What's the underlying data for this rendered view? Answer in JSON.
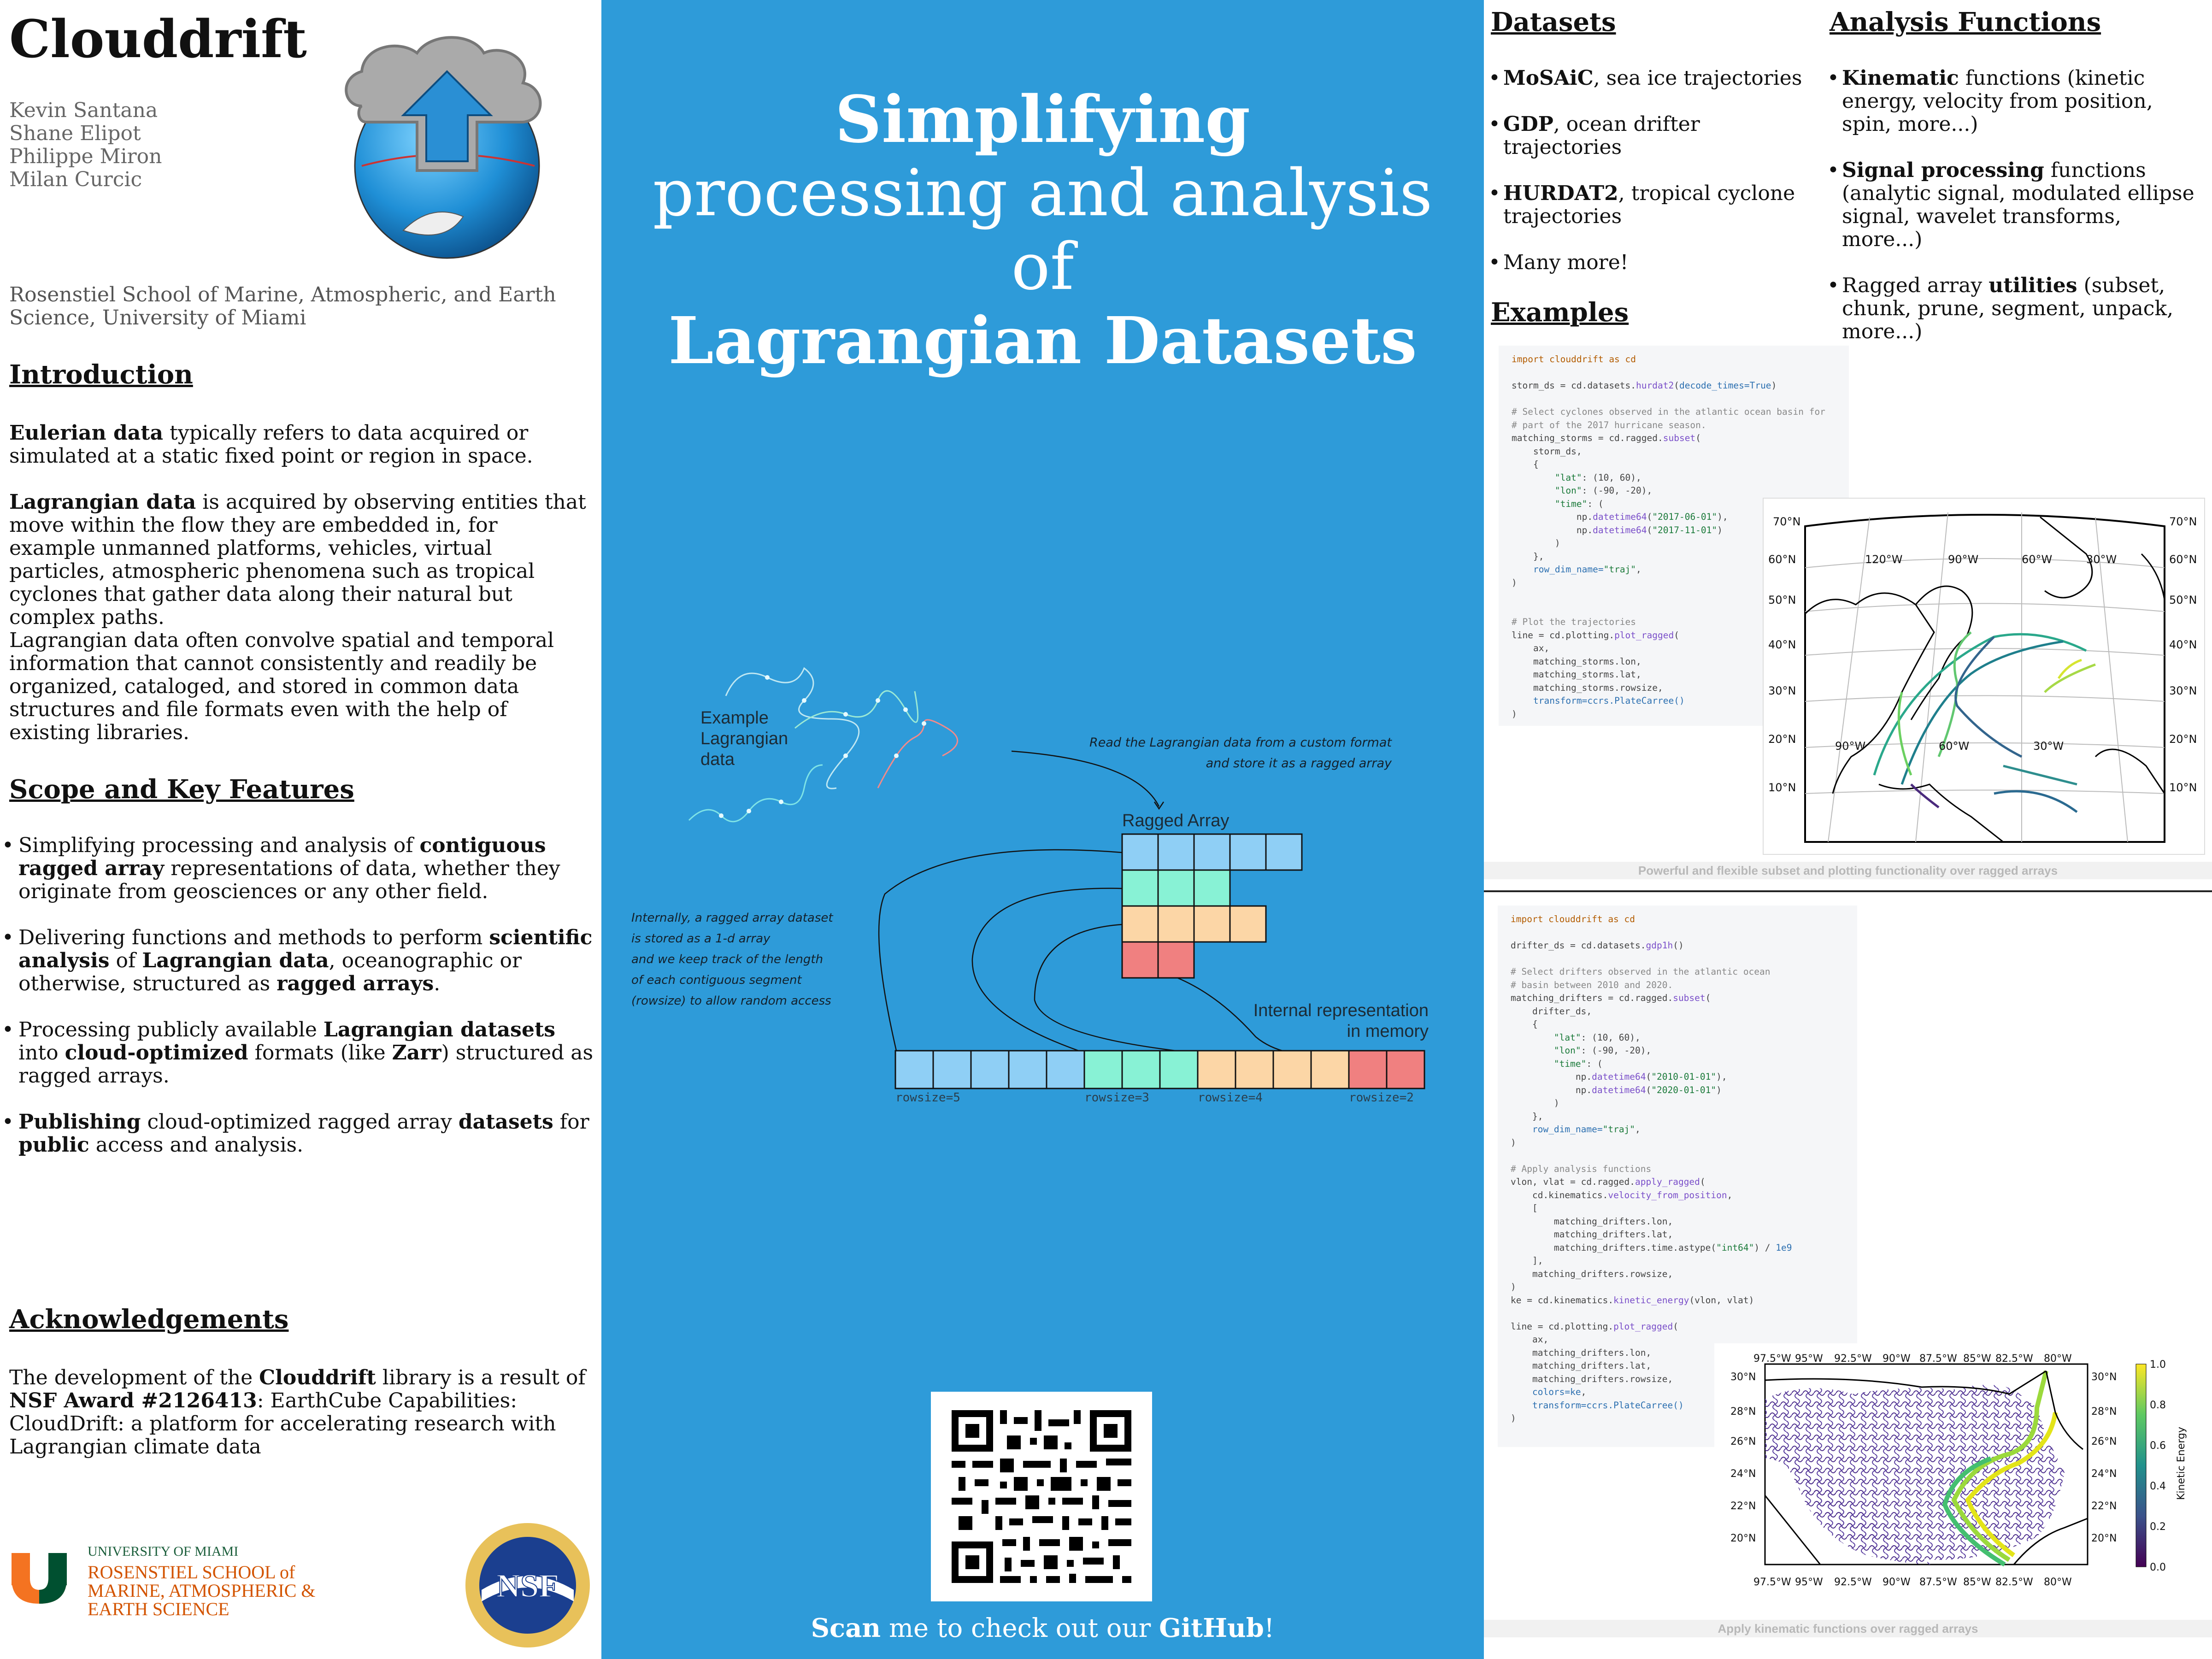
{
  "left": {
    "title": "Clouddrift",
    "authors": [
      "Kevin Santana",
      "Shane Elipot",
      "Philippe Miron",
      "Milan Curcic"
    ],
    "affiliation": "Rosenstiel School of Marine, Atmospheric, and Earth Science, University of Miami",
    "introduction": {
      "heading": "Introduction",
      "p1_bold": "Eulerian data",
      "p1_rest": " typically refers to data acquired or simulated at a static fixed point or region in space.",
      "p2_bold": "Lagrangian data",
      "p2_rest": " is acquired by observing entities that move within the flow they are embedded in, for example unmanned platforms, vehicles, virtual particles, atmospheric phenomena such as tropical cyclones that gather data along their natural but complex paths.",
      "p3": "Lagrangian data often convolve spatial and temporal information that cannot consistently and readily be organized, cataloged, and stored in common data structures and file formats even with the help of existing libraries."
    },
    "scope": {
      "heading": "Scope and Key Features",
      "b1": [
        "Simplifying processing and analysis of ",
        "contiguous ragged array",
        " representations of data, whether they originate from geosciences or any other field."
      ],
      "b2": [
        "Delivering functions and methods to perform ",
        "scientific analysis",
        " of ",
        "Lagrangian data",
        ", oceanographic or otherwise, structured as ",
        "ragged arrays",
        "."
      ],
      "b3": [
        "Processing publicly available ",
        "Lagrangian datasets",
        " into ",
        "cloud-optimized",
        " formats (like ",
        "Zarr",
        ") structured as ragged arrays."
      ],
      "b4": [
        "Publishing",
        " cloud-optimized ragged array ",
        "datasets",
        " for ",
        "public",
        " access and analysis."
      ]
    },
    "acknowledgements": {
      "heading": "Acknowledgements",
      "t1": "The development of the ",
      "b1": "Clouddrift",
      "t2": " library is a result of ",
      "b2": "NSF Award #2126413",
      "t3": ": EarthCube Capabilities: CloudDrift: a platform for accelerating research with Lagrangian climate data"
    },
    "um_logo": {
      "line1": "UNIVERSITY OF MIAMI",
      "line2": "ROSENSTIEL SCHOOL of MARINE, ATMOSPHERIC & EARTH SCIENCE"
    },
    "nsf_logo": "NSF"
  },
  "middle": {
    "title_line1": "Simplifying",
    "title_line2": "processing and analysis",
    "title_line3": "of",
    "title_line4": "Lagrangian Datasets",
    "diagram": {
      "example_label": [
        "Example",
        "Lagrangian",
        "data"
      ],
      "read_note": [
        "Read the Lagrangian data from a custom format",
        "and store it as a ragged array"
      ],
      "ragged_label": "Ragged Array",
      "internal_note": [
        "Internally, a ragged array dataset",
        "is stored as a 1-d array",
        "and we keep track of the length",
        "of each contiguous segment",
        "(rowsize) to allow random access"
      ],
      "memory_label": [
        "Internal representation",
        "in memory"
      ],
      "rowsizes": [
        "rowsize=5",
        "rowsize=3",
        "rowsize=4",
        "rowsize=2"
      ]
    },
    "scan": {
      "b1": "Scan",
      "t1": " me to check out our ",
      "b2": "GitHub",
      "t2": "!"
    }
  },
  "right": {
    "datasets": {
      "heading": "Datasets",
      "items": [
        {
          "bold": "MoSAiC",
          "rest": ", sea ice trajectories"
        },
        {
          "bold": "GDP",
          "rest": ", ocean drifter trajectories"
        },
        {
          "bold": "HURDAT2",
          "rest": ", tropical cyclone trajectories"
        },
        {
          "bold": "",
          "rest": "Many more!"
        }
      ]
    },
    "functions": {
      "heading": "Analysis Functions",
      "items": [
        {
          "pre": "",
          "bold": "Kinematic",
          "rest": " functions (kinetic energy, velocity from position, spin, more...)"
        },
        {
          "pre": "",
          "bold": "Signal processing",
          "rest": " functions (analytic signal, modulated ellipse signal, wavelet transforms, more...)"
        },
        {
          "pre": "Ragged array ",
          "bold": "utilities",
          "rest": " (subset, chunk, prune, segment, unpack, more...)"
        }
      ]
    },
    "examples_heading": "Examples",
    "caption1": "Powerful and flexible subset and plotting functionality over ragged arrays",
    "caption2": "Apply kinematic functions over ragged arrays",
    "plot1": {
      "lat_labels": [
        "70°N",
        "60°N",
        "50°N",
        "40°N",
        "30°N",
        "20°N",
        "10°N"
      ],
      "lon_labels": [
        "120°W",
        "90°W",
        "60°W",
        "30°W"
      ],
      "lon_labels_bottom": [
        "90°W",
        "60°W",
        "30°W"
      ]
    },
    "plot2": {
      "lon_labels": [
        "97.5°W",
        "95°W",
        "92.5°W",
        "90°W",
        "87.5°W",
        "85°W",
        "82.5°W",
        "80°W"
      ],
      "lat_labels": [
        "30°N",
        "28°N",
        "26°N",
        "24°N",
        "22°N",
        "20°N"
      ],
      "colorbar_ticks": [
        "1.0",
        "0.8",
        "0.6",
        "0.4",
        "0.2",
        "0.0"
      ],
      "colorbar_label": "Kinetic Energy"
    }
  }
}
